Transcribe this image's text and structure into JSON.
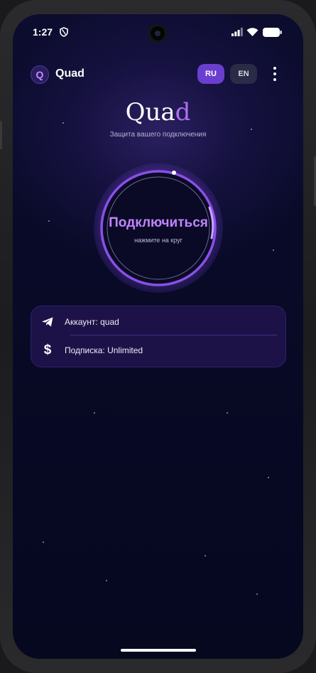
{
  "status_bar": {
    "time": "1:27",
    "icons": [
      "shield-icon",
      "signal-icon",
      "wifi-icon",
      "battery-icon"
    ]
  },
  "header": {
    "logo_letter": "Q",
    "app_name": "Quad",
    "languages": [
      {
        "label": "RU",
        "active": true
      },
      {
        "label": "EN",
        "active": false
      }
    ],
    "menu_icon": "more-vertical-icon"
  },
  "brand": {
    "title_main": "Qua",
    "title_accent": "d",
    "subtitle": "Защита вашего подключения"
  },
  "connect": {
    "label": "Подключиться",
    "hint": "нажмите на круг"
  },
  "info": {
    "account": {
      "icon": "telegram-icon",
      "text": "Аккаунт: quad"
    },
    "subscription": {
      "icon": "dollar-icon",
      "text": "Подписка: Unlimited"
    }
  },
  "colors": {
    "accent": "#b06ef5",
    "lang_active": "#6a3fd0",
    "background": "#0a0b2c",
    "card": "#1d1248"
  }
}
